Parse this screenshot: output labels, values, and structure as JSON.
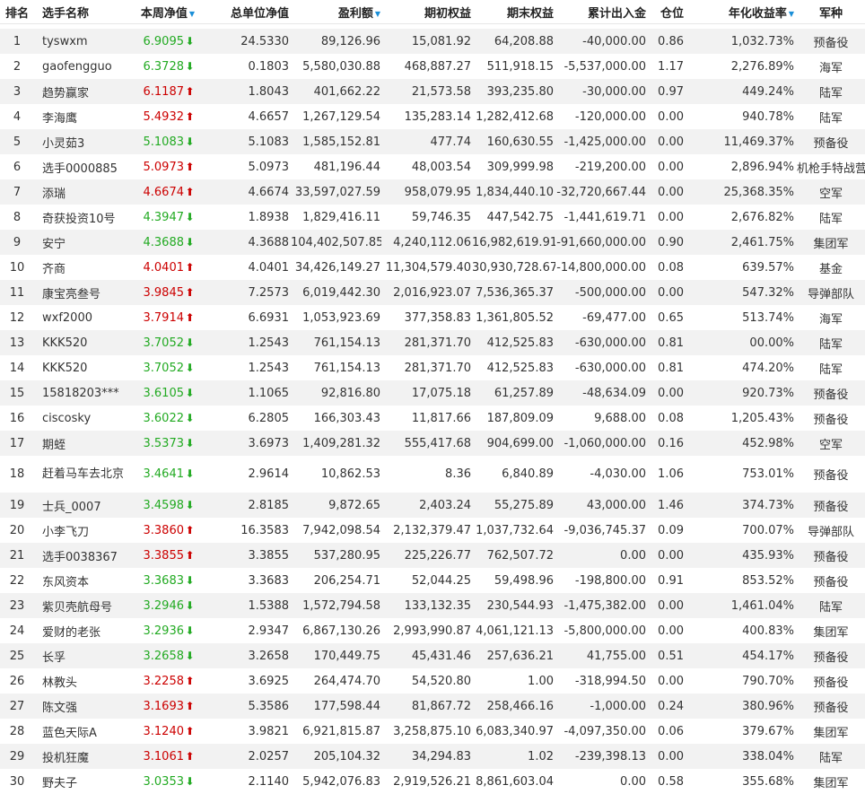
{
  "headers": {
    "rank": "排名",
    "name": "选手名称",
    "nav": "本周净值",
    "unit_nav": "总单位净值",
    "profit": "盈利额",
    "initial_equity": "期初权益",
    "final_equity": "期末权益",
    "cumulative_flow": "累计出入金",
    "position": "仓位",
    "annual_return": "年化收益率",
    "army": "军种"
  },
  "sort_icon": "sort-triangle-icon",
  "colors": {
    "up": "#cc0000",
    "down": "#22aa22",
    "stripe": "#f2f2f2",
    "sort": "#1a8fd8"
  },
  "rows": [
    {
      "rank": "1",
      "name": "tyswxm",
      "nav": "6.9095",
      "dir": "down",
      "unit_nav": "24.5330",
      "profit": "89,126.96",
      "initial_equity": "15,081.92",
      "final_equity": "64,208.88",
      "cumulative_flow": "-40,000.00",
      "position": "0.86",
      "annual_return": "1,032.73%",
      "army": "预备役"
    },
    {
      "rank": "2",
      "name": "gaofengguo",
      "nav": "6.3728",
      "dir": "down",
      "unit_nav": "0.1803",
      "profit": "5,580,030.88",
      "initial_equity": "468,887.27",
      "final_equity": "511,918.15",
      "cumulative_flow": "-5,537,000.00",
      "position": "1.17",
      "annual_return": "2,276.89%",
      "army": "海军"
    },
    {
      "rank": "3",
      "name": "趋势赢家",
      "nav": "6.1187",
      "dir": "up",
      "unit_nav": "1.8043",
      "profit": "401,662.22",
      "initial_equity": "21,573.58",
      "final_equity": "393,235.80",
      "cumulative_flow": "-30,000.00",
      "position": "0.97",
      "annual_return": "449.24%",
      "army": "陆军"
    },
    {
      "rank": "4",
      "name": "李海鹰",
      "nav": "5.4932",
      "dir": "up",
      "unit_nav": "4.6657",
      "profit": "1,267,129.54",
      "initial_equity": "135,283.14",
      "final_equity": "1,282,412.68",
      "cumulative_flow": "-120,000.00",
      "position": "0.00",
      "annual_return": "940.78%",
      "army": "陆军"
    },
    {
      "rank": "5",
      "name": "小灵茹3",
      "nav": "5.1083",
      "dir": "down",
      "unit_nav": "5.1083",
      "profit": "1,585,152.81",
      "initial_equity": "477.74",
      "final_equity": "160,630.55",
      "cumulative_flow": "-1,425,000.00",
      "position": "0.00",
      "annual_return": "11,469.37%",
      "army": "预备役"
    },
    {
      "rank": "6",
      "name": "选手0000885",
      "nav": "5.0973",
      "dir": "up",
      "unit_nav": "5.0973",
      "profit": "481,196.44",
      "initial_equity": "48,003.54",
      "final_equity": "309,999.98",
      "cumulative_flow": "-219,200.00",
      "position": "0.00",
      "annual_return": "2,896.94%",
      "army": "机枪手特战营"
    },
    {
      "rank": "7",
      "name": "添瑞",
      "nav": "4.6674",
      "dir": "up",
      "unit_nav": "4.6674",
      "profit": "33,597,027.59",
      "initial_equity": "958,079.95",
      "final_equity": "1,834,440.10",
      "cumulative_flow": "-32,720,667.44",
      "position": "0.00",
      "annual_return": "25,368.35%",
      "army": "空军"
    },
    {
      "rank": "8",
      "name": "奇获投资10号",
      "nav": "4.3947",
      "dir": "down",
      "unit_nav": "1.8938",
      "profit": "1,829,416.11",
      "initial_equity": "59,746.35",
      "final_equity": "447,542.75",
      "cumulative_flow": "-1,441,619.71",
      "position": "0.00",
      "annual_return": "2,676.82%",
      "army": "陆军"
    },
    {
      "rank": "9",
      "name": "安宁",
      "nav": "4.3688",
      "dir": "down",
      "unit_nav": "4.3688",
      "profit": "104,402,507.85",
      "initial_equity": "4,240,112.06",
      "final_equity": "16,982,619.91",
      "cumulative_flow": "-91,660,000.00",
      "position": "0.90",
      "annual_return": "2,461.75%",
      "army": "集团军"
    },
    {
      "rank": "10",
      "name": "齐商",
      "nav": "4.0401",
      "dir": "up",
      "unit_nav": "4.0401",
      "profit": "34,426,149.27",
      "initial_equity": "11,304,579.40",
      "final_equity": "30,930,728.67",
      "cumulative_flow": "-14,800,000.00",
      "position": "0.08",
      "annual_return": "639.57%",
      "army": "基金"
    },
    {
      "rank": "11",
      "name": "康宝亮叁号",
      "nav": "3.9845",
      "dir": "up",
      "unit_nav": "7.2573",
      "profit": "6,019,442.30",
      "initial_equity": "2,016,923.07",
      "final_equity": "7,536,365.37",
      "cumulative_flow": "-500,000.00",
      "position": "0.00",
      "annual_return": "547.32%",
      "army": "导弹部队"
    },
    {
      "rank": "12",
      "name": "wxf2000",
      "nav": "3.7914",
      "dir": "up",
      "unit_nav": "6.6931",
      "profit": "1,053,923.69",
      "initial_equity": "377,358.83",
      "final_equity": "1,361,805.52",
      "cumulative_flow": "-69,477.00",
      "position": "0.65",
      "annual_return": "513.74%",
      "army": "海军"
    },
    {
      "rank": "13",
      "name": "KKK520",
      "nav": "3.7052",
      "dir": "down",
      "unit_nav": "1.2543",
      "profit": "761,154.13",
      "initial_equity": "281,371.70",
      "final_equity": "412,525.83",
      "cumulative_flow": "-630,000.00",
      "position": "0.81",
      "annual_return": "00.00%",
      "army": "陆军"
    },
    {
      "rank": "14",
      "name": "KKK520",
      "nav": "3.7052",
      "dir": "down",
      "unit_nav": "1.2543",
      "profit": "761,154.13",
      "initial_equity": "281,371.70",
      "final_equity": "412,525.83",
      "cumulative_flow": "-630,000.00",
      "position": "0.81",
      "annual_return": "474.20%",
      "army": "陆军"
    },
    {
      "rank": "15",
      "name": "15818203***",
      "nav": "3.6105",
      "dir": "down",
      "unit_nav": "1.1065",
      "profit": "92,816.80",
      "initial_equity": "17,075.18",
      "final_equity": "61,257.89",
      "cumulative_flow": "-48,634.09",
      "position": "0.00",
      "annual_return": "920.73%",
      "army": "预备役"
    },
    {
      "rank": "16",
      "name": "ciscosky",
      "nav": "3.6022",
      "dir": "down",
      "unit_nav": "6.2805",
      "profit": "166,303.43",
      "initial_equity": "11,817.66",
      "final_equity": "187,809.09",
      "cumulative_flow": "9,688.00",
      "position": "0.08",
      "annual_return": "1,205.43%",
      "army": "预备役"
    },
    {
      "rank": "17",
      "name": "期蛭",
      "nav": "3.5373",
      "dir": "down",
      "unit_nav": "3.6973",
      "profit": "1,409,281.32",
      "initial_equity": "555,417.68",
      "final_equity": "904,699.00",
      "cumulative_flow": "-1,060,000.00",
      "position": "0.16",
      "annual_return": "452.98%",
      "army": "空军"
    },
    {
      "rank": "18",
      "name": "赶着马车去北京",
      "nav": "3.4641",
      "dir": "down",
      "unit_nav": "2.9614",
      "profit": "10,862.53",
      "initial_equity": "8.36",
      "final_equity": "6,840.89",
      "cumulative_flow": "-4,030.00",
      "position": "1.06",
      "annual_return": "753.01%",
      "army": "预备役"
    },
    {
      "rank": "19",
      "name": "士兵_0007",
      "nav": "3.4598",
      "dir": "down",
      "unit_nav": "2.8185",
      "profit": "9,872.65",
      "initial_equity": "2,403.24",
      "final_equity": "55,275.89",
      "cumulative_flow": "43,000.00",
      "position": "1.46",
      "annual_return": "374.73%",
      "army": "预备役"
    },
    {
      "rank": "20",
      "name": "小李飞刀",
      "nav": "3.3860",
      "dir": "up",
      "unit_nav": "16.3583",
      "profit": "7,942,098.54",
      "initial_equity": "2,132,379.47",
      "final_equity": "1,037,732.64",
      "cumulative_flow": "-9,036,745.37",
      "position": "0.09",
      "annual_return": "700.07%",
      "army": "导弹部队"
    },
    {
      "rank": "21",
      "name": "选手0038367",
      "nav": "3.3855",
      "dir": "up",
      "unit_nav": "3.3855",
      "profit": "537,280.95",
      "initial_equity": "225,226.77",
      "final_equity": "762,507.72",
      "cumulative_flow": "0.00",
      "position": "0.00",
      "annual_return": "435.93%",
      "army": "预备役"
    },
    {
      "rank": "22",
      "name": "东风资本",
      "nav": "3.3683",
      "dir": "down",
      "unit_nav": "3.3683",
      "profit": "206,254.71",
      "initial_equity": "52,044.25",
      "final_equity": "59,498.96",
      "cumulative_flow": "-198,800.00",
      "position": "0.91",
      "annual_return": "853.52%",
      "army": "预备役"
    },
    {
      "rank": "23",
      "name": "紫贝壳航母号",
      "nav": "3.2946",
      "dir": "down",
      "unit_nav": "1.5388",
      "profit": "1,572,794.58",
      "initial_equity": "133,132.35",
      "final_equity": "230,544.93",
      "cumulative_flow": "-1,475,382.00",
      "position": "0.00",
      "annual_return": "1,461.04%",
      "army": "陆军"
    },
    {
      "rank": "24",
      "name": "爱财的老张",
      "nav": "3.2936",
      "dir": "down",
      "unit_nav": "2.9347",
      "profit": "6,867,130.26",
      "initial_equity": "2,993,990.87",
      "final_equity": "4,061,121.13",
      "cumulative_flow": "-5,800,000.00",
      "position": "0.00",
      "annual_return": "400.83%",
      "army": "集团军"
    },
    {
      "rank": "25",
      "name": "长孚",
      "nav": "3.2658",
      "dir": "down",
      "unit_nav": "3.2658",
      "profit": "170,449.75",
      "initial_equity": "45,431.46",
      "final_equity": "257,636.21",
      "cumulative_flow": "41,755.00",
      "position": "0.51",
      "annual_return": "454.17%",
      "army": "预备役"
    },
    {
      "rank": "26",
      "name": "林教头",
      "nav": "3.2258",
      "dir": "up",
      "unit_nav": "3.6925",
      "profit": "264,474.70",
      "initial_equity": "54,520.80",
      "final_equity": "1.00",
      "cumulative_flow": "-318,994.50",
      "position": "0.00",
      "annual_return": "790.70%",
      "army": "预备役"
    },
    {
      "rank": "27",
      "name": "陈文强",
      "nav": "3.1693",
      "dir": "up",
      "unit_nav": "5.3586",
      "profit": "177,598.44",
      "initial_equity": "81,867.72",
      "final_equity": "258,466.16",
      "cumulative_flow": "-1,000.00",
      "position": "0.24",
      "annual_return": "380.96%",
      "army": "预备役"
    },
    {
      "rank": "28",
      "name": "蓝色天际A",
      "nav": "3.1240",
      "dir": "up",
      "unit_nav": "3.9821",
      "profit": "6,921,815.87",
      "initial_equity": "3,258,875.10",
      "final_equity": "6,083,340.97",
      "cumulative_flow": "-4,097,350.00",
      "position": "0.06",
      "annual_return": "379.67%",
      "army": "集团军"
    },
    {
      "rank": "29",
      "name": "投机狂魔",
      "nav": "3.1061",
      "dir": "up",
      "unit_nav": "2.0257",
      "profit": "205,104.32",
      "initial_equity": "34,294.83",
      "final_equity": "1.02",
      "cumulative_flow": "-239,398.13",
      "position": "0.00",
      "annual_return": "338.04%",
      "army": "陆军"
    },
    {
      "rank": "30",
      "name": "野夫子",
      "nav": "3.0353",
      "dir": "down",
      "unit_nav": "2.1140",
      "profit": "5,942,076.83",
      "initial_equity": "2,919,526.21",
      "final_equity": "8,861,603.04",
      "cumulative_flow": "0.00",
      "position": "0.58",
      "annual_return": "355.68%",
      "army": "集团军"
    }
  ]
}
